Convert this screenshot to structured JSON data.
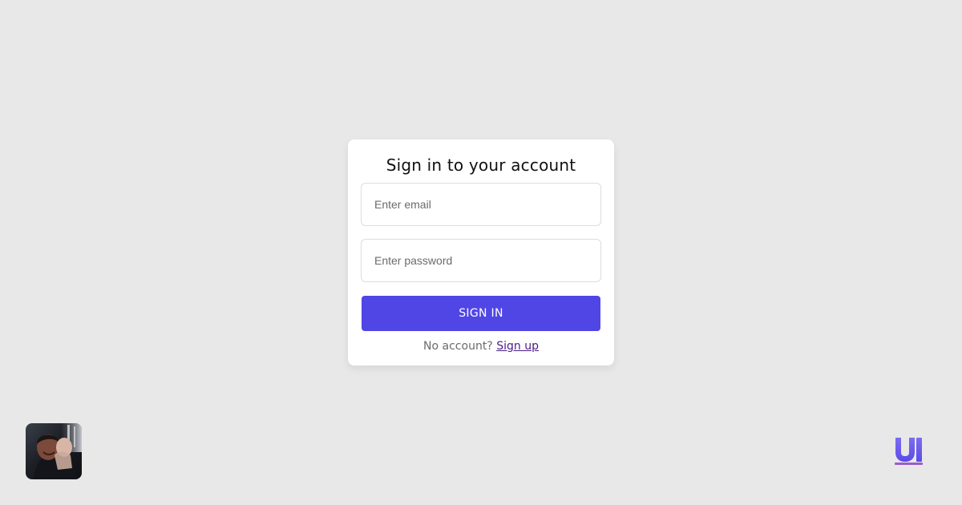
{
  "login": {
    "title": "Sign in to your account",
    "email_placeholder": "Enter email",
    "password_placeholder": "Enter password",
    "submit_label": "SIGN IN",
    "footer_text": "No account?",
    "signup_label": "Sign up"
  },
  "colors": {
    "background": "#e8e8e8",
    "card": "#ffffff",
    "primary_button": "#4f46e5",
    "link": "#4b1b8a"
  },
  "icons": {
    "avatar": "user-photo",
    "logo": "ui-logo-icon"
  }
}
